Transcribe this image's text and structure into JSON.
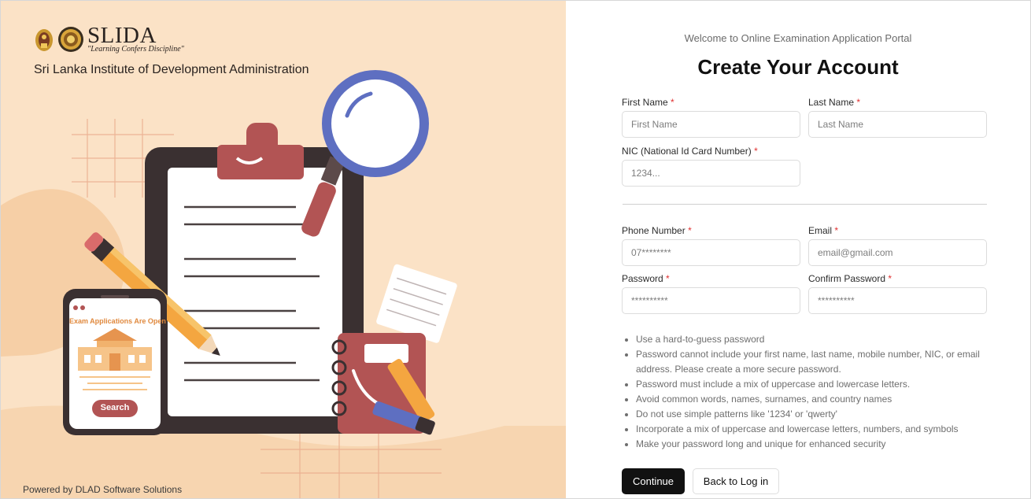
{
  "brand": {
    "name": "SLIDA",
    "tagline": "\"Learning Confers Discipline\"",
    "institute": "Sri Lanka Institute of Development Administration",
    "powered_by": "Powered by DLAD Software Solutions"
  },
  "illustration": {
    "phone_heading": "Exam Applications Are Open",
    "phone_button": "Search"
  },
  "form": {
    "welcome": "Welcome to Online Examination Application Portal",
    "title": "Create Your Account",
    "required_mark": "*",
    "first_name": {
      "label": "First Name",
      "placeholder": "First Name"
    },
    "last_name": {
      "label": "Last Name",
      "placeholder": "Last Name"
    },
    "nic": {
      "label": "NIC (National Id Card Number)",
      "placeholder": "1234..."
    },
    "phone": {
      "label": "Phone Number",
      "placeholder": "07********"
    },
    "email": {
      "label": "Email",
      "placeholder": "email@gmail.com"
    },
    "password": {
      "label": "Password",
      "placeholder": "**********"
    },
    "confirm_password": {
      "label": "Confirm Password",
      "placeholder": "**********"
    },
    "password_rules": [
      "Use a hard-to-guess password",
      "Password cannot include your first name, last name, mobile number, NIC, or email address. Please create a more secure password.",
      "Password must include a mix of uppercase and lowercase letters.",
      "Avoid common words, names, surnames, and country names",
      "Do not use simple patterns like '1234' or 'qwerty'",
      "Incorporate a mix of uppercase and lowercase letters, numbers, and symbols",
      "Make your password long and unique for enhanced security"
    ],
    "continue_label": "Continue",
    "back_label": "Back to Log in"
  },
  "colors": {
    "left_panel_bg": "#fbe2c6",
    "primary_button": "#111111",
    "required": "#e03131"
  }
}
